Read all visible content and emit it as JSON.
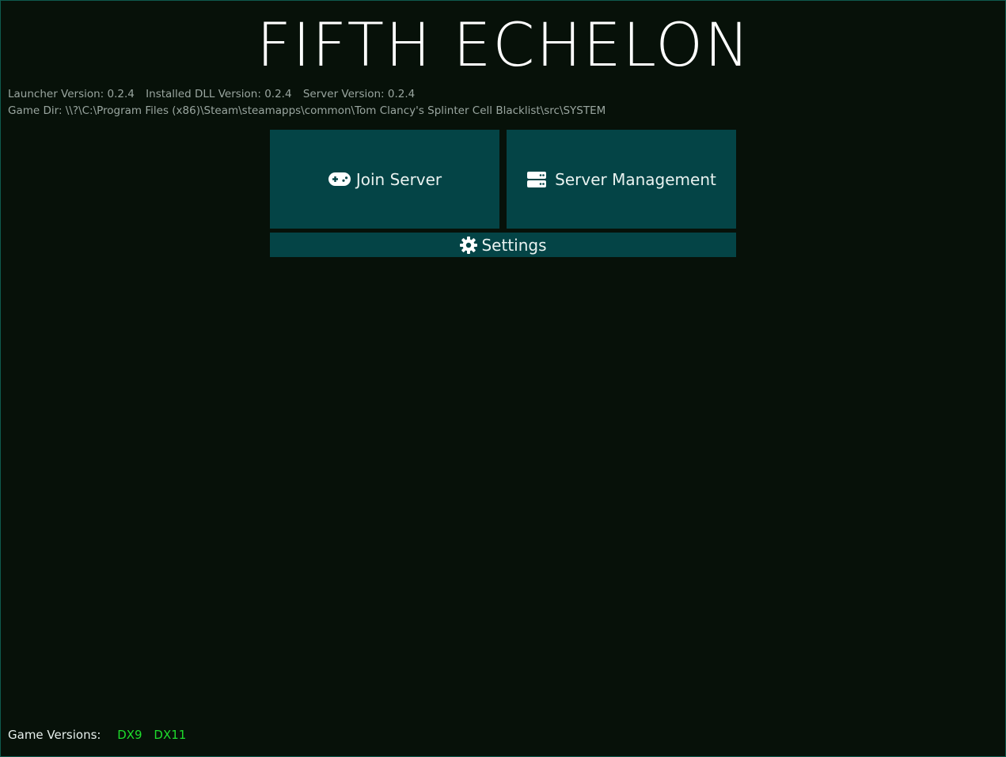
{
  "app": {
    "title": "FIFTH ECHELON"
  },
  "info": {
    "launcher_version": "Launcher Version: 0.2.4",
    "dll_version": "Installed DLL Version: 0.2.4",
    "server_version": "Server Version: 0.2.4",
    "game_dir": "Game Dir: \\\\?\\C:\\Program Files (x86)\\Steam\\steamapps\\common\\Tom Clancy's Splinter Cell Blacklist\\src\\SYSTEM"
  },
  "buttons": {
    "join_server": "Join Server",
    "server_management": "Server Management",
    "settings": "Settings"
  },
  "icons": {
    "join_server": "gamepad-icon",
    "server_management": "server-icon",
    "settings": "gear-icon"
  },
  "footer": {
    "label": "Game Versions:",
    "versions": [
      "DX9",
      "DX11"
    ]
  },
  "colors": {
    "background": "#071109",
    "button": "#044446",
    "version_green": "#1edc2c",
    "border": "#0f5a4e"
  }
}
